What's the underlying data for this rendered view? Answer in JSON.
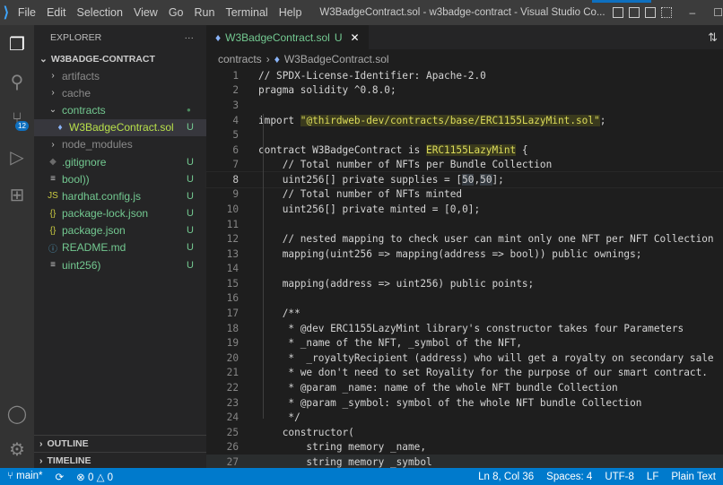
{
  "titlebar": {
    "menus": [
      "File",
      "Edit",
      "Selection",
      "View",
      "Go",
      "Run",
      "Terminal",
      "Help"
    ],
    "title": "W3BadgeContract.sol - w3badge-contract - Visual Studio Co..."
  },
  "activity": {
    "scm_badge": "12"
  },
  "sidebar": {
    "header": "EXPLORER",
    "more": "···",
    "folder": "W3BADGE-CONTRACT",
    "items": [
      {
        "label": "artifacts",
        "kind": "folder",
        "status": ""
      },
      {
        "label": "cache",
        "kind": "folder",
        "status": ""
      },
      {
        "label": "contracts",
        "kind": "folder-open",
        "status": "●"
      },
      {
        "label": "W3BadgeContract.sol",
        "kind": "sol",
        "status": "U"
      },
      {
        "label": "node_modules",
        "kind": "folder",
        "status": ""
      },
      {
        "label": ".gitignore",
        "kind": "git",
        "status": "U"
      },
      {
        "label": "bool))",
        "kind": "text",
        "status": "U"
      },
      {
        "label": "hardhat.config.js",
        "kind": "js",
        "status": "U"
      },
      {
        "label": "package-lock.json",
        "kind": "json",
        "status": "U"
      },
      {
        "label": "package.json",
        "kind": "json",
        "status": "U"
      },
      {
        "label": "README.md",
        "kind": "info",
        "status": "U"
      },
      {
        "label": "uint256)",
        "kind": "text",
        "status": "U"
      }
    ],
    "outline": "OUTLINE",
    "timeline": "TIMELINE"
  },
  "editor": {
    "tab": {
      "label": "W3BadgeContract.sol",
      "status": "U"
    },
    "breadcrumb": [
      "contracts",
      "W3BadgeContract.sol"
    ],
    "lines": [
      [
        {
          "t": "// SPDX-License-Identifier: Apache-2.0"
        }
      ],
      [
        {
          "t": "pragma solidity ^0.8.0;"
        }
      ],
      [
        {
          "t": ""
        }
      ],
      [
        {
          "t": "import "
        },
        {
          "t": "\"@thirdweb-dev/contracts/base/ERC1155LazyMint.sol\"",
          "h": "hl"
        },
        {
          "t": ";"
        }
      ],
      [
        {
          "t": ""
        }
      ],
      [
        {
          "t": "contract W3BadgeContract is "
        },
        {
          "t": "ERC1155LazyMint",
          "h": "hl"
        },
        {
          "t": " {"
        }
      ],
      [
        {
          "t": "    // Total number of NFTs per Bundle Collection"
        }
      ],
      [
        {
          "t": "    uint256[] private supplies = ["
        },
        {
          "t": "50",
          "h": "tw"
        },
        {
          "t": ","
        },
        {
          "t": "50",
          "h": "tw"
        },
        {
          "t": "];"
        }
      ],
      [
        {
          "t": "    // Total number of NFTs minted"
        }
      ],
      [
        {
          "t": "    uint256[] private minted = [0,0];"
        }
      ],
      [
        {
          "t": ""
        }
      ],
      [
        {
          "t": "    // nested mapping to check user can mint only one NFT per NFT Collection"
        }
      ],
      [
        {
          "t": "    mapping(uint256 => mapping(address => bool)) public ownings;"
        }
      ],
      [
        {
          "t": ""
        }
      ],
      [
        {
          "t": "    mapping(address => uint256) public points;"
        }
      ],
      [
        {
          "t": ""
        }
      ],
      [
        {
          "t": "    /**"
        }
      ],
      [
        {
          "t": "     * @dev ERC1155LazyMint library's constructor takes four Parameters"
        }
      ],
      [
        {
          "t": "     * _name of the NFT, _symbol of the NFT,"
        }
      ],
      [
        {
          "t": "     *  _royaltyRecipient (address) who will get a royalty on secondary sale"
        }
      ],
      [
        {
          "t": "     * we don't need to set Royality for the purpose of our smart contract."
        }
      ],
      [
        {
          "t": "     * @param _name: name of the whole NFT bundle Collection"
        }
      ],
      [
        {
          "t": "     * @param _symbol: symbol of the whole NFT bundle Collection"
        }
      ],
      [
        {
          "t": "     */"
        }
      ],
      [
        {
          "t": "    constructor("
        }
      ],
      [
        {
          "t": "        string memory _name,"
        }
      ],
      [
        {
          "t": "        string memory _symbol"
        }
      ]
    ],
    "current_line": 8
  },
  "status": {
    "branch": "main*",
    "errors": "0",
    "warnings": "0",
    "position": "Ln 8, Col 36",
    "spaces": "Spaces: 4",
    "encoding": "UTF-8",
    "eol": "LF",
    "language": "Plain Text"
  }
}
